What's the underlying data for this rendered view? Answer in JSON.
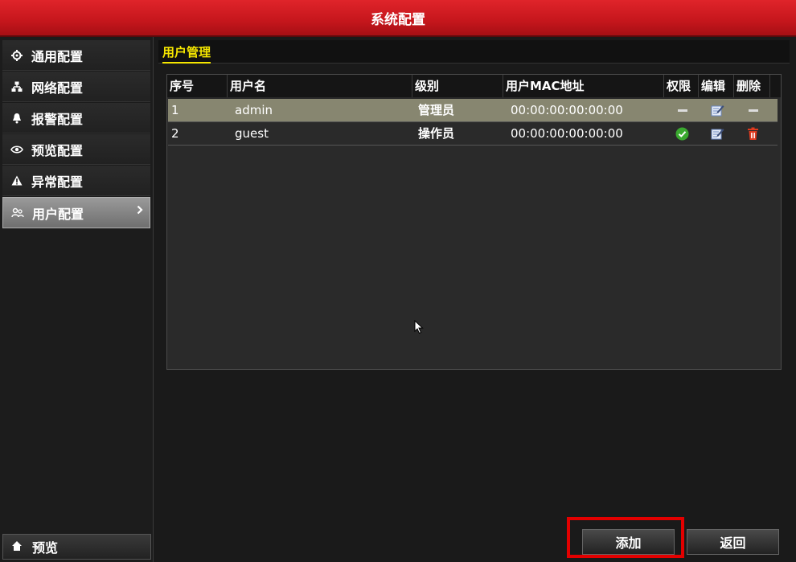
{
  "window": {
    "title": "系统配置"
  },
  "sidebar": {
    "items": [
      {
        "label": "通用配置",
        "icon": "gear-icon"
      },
      {
        "label": "网络配置",
        "icon": "network-icon"
      },
      {
        "label": "报警配置",
        "icon": "alarm-icon"
      },
      {
        "label": "预览配置",
        "icon": "eye-icon"
      },
      {
        "label": "异常配置",
        "icon": "warning-icon"
      },
      {
        "label": "用户配置",
        "icon": "users-icon",
        "active": true
      }
    ],
    "preview_label": "预览"
  },
  "main": {
    "tab": "用户管理",
    "table": {
      "headers": [
        "序号",
        "用户名",
        "级别",
        "用户MAC地址",
        "权限",
        "编辑",
        "删除"
      ],
      "rows": [
        {
          "index": "1",
          "username": "admin",
          "level": "管理员",
          "mac": "00:00:00:00:00:00",
          "permission": "none",
          "edit": "edit",
          "delete": "none",
          "selected": true
        },
        {
          "index": "2",
          "username": "guest",
          "level": "操作员",
          "mac": "00:00:00:00:00:00",
          "permission": "check",
          "edit": "edit",
          "delete": "trash",
          "selected": false
        }
      ]
    }
  },
  "buttons": {
    "add": "添加",
    "back": "返回"
  },
  "colors": {
    "title_red": "#c5161c",
    "tab_yellow": "#f5e600",
    "selected_row": "#878670",
    "highlight": "#e30000"
  }
}
